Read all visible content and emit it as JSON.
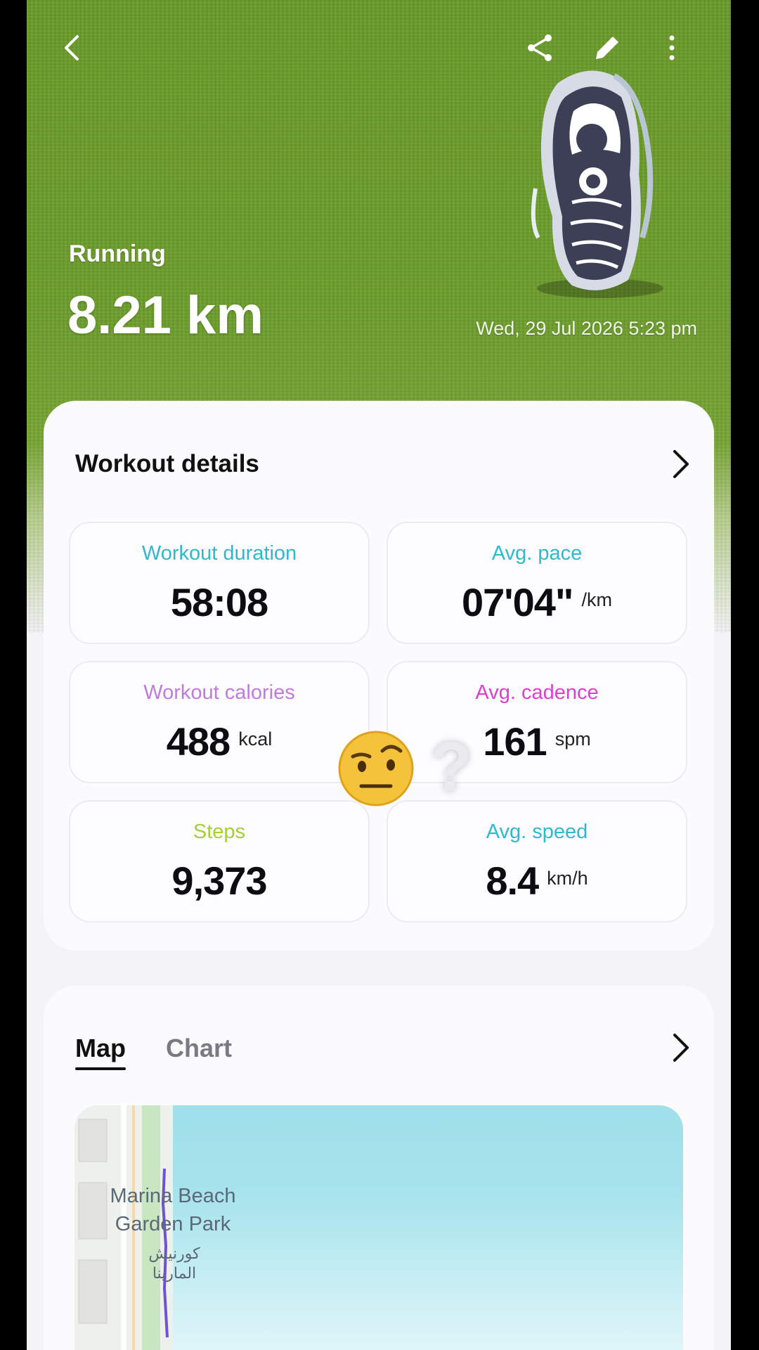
{
  "header": {
    "activity": "Running",
    "distance_value": "8.21",
    "distance_unit": "km",
    "datetime": "Wed, 29 Jul 2026 5:23 pm",
    "icons": [
      "back-icon",
      "share-icon",
      "edit-icon",
      "more-icon"
    ]
  },
  "workout_details": {
    "title": "Workout details",
    "tiles": [
      {
        "label": "Workout duration",
        "value": "58:08",
        "unit": "",
        "color": "#2fb8ce"
      },
      {
        "label": "Avg. pace",
        "value": "07'04\"",
        "unit": "/km",
        "color": "#2fb8ce"
      },
      {
        "label": "Workout calories",
        "value": "488",
        "unit": "kcal",
        "color": "#c07be0"
      },
      {
        "label": "Avg. cadence",
        "value": "161",
        "unit": "spm",
        "color": "#e03ecf"
      },
      {
        "label": "Steps",
        "value": "9,373",
        "unit": "",
        "color": "#a7cf3a"
      },
      {
        "label": "Avg. speed",
        "value": "8.4",
        "unit": "km/h",
        "color": "#2fb8ce"
      }
    ]
  },
  "overlay": {
    "emoji": "face-with-raised-eyebrow",
    "question": "?"
  },
  "map_section": {
    "tabs": [
      {
        "label": "Map",
        "selected": true
      },
      {
        "label": "Chart",
        "selected": false
      }
    ],
    "place_line1": "Marina Beach",
    "place_line2": "Garden Park",
    "place_ar_line1": "كورنيش",
    "place_ar_line2": "المارينا"
  }
}
